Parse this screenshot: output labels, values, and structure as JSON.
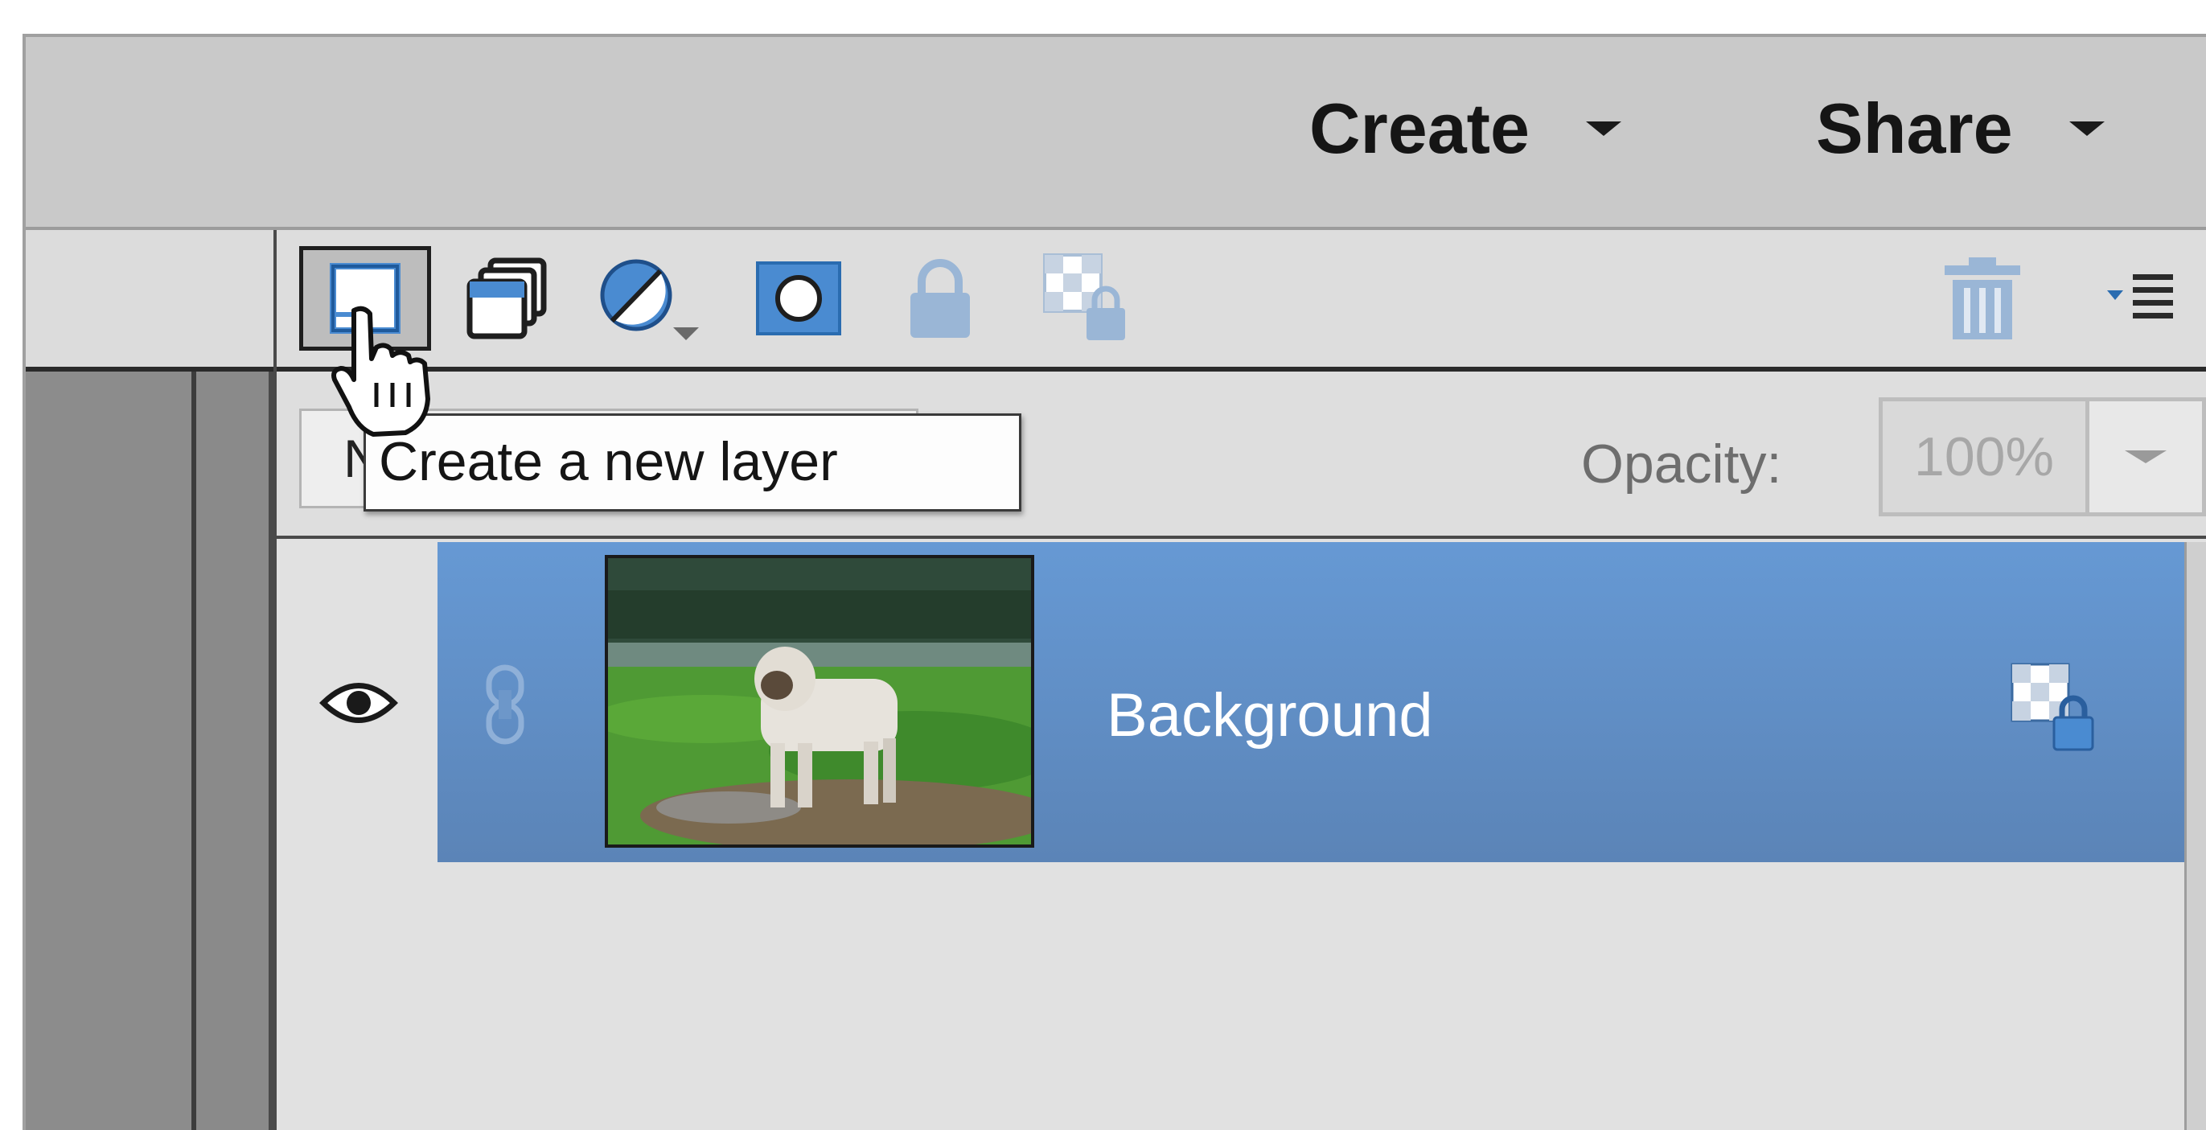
{
  "menubar": {
    "create_label": "Create",
    "share_label": "Share"
  },
  "layers_panel": {
    "toolbar": {
      "new_layer_icon": "new-layer-icon",
      "duplicate_icon": "stacked-pages-icon",
      "adjustment_icon": "half-circle-icon",
      "mask_icon": "layer-mask-icon",
      "lock_all_icon": "lock-icon",
      "lock_transparency_icon": "checker-lock-icon",
      "delete_icon": "trash-icon",
      "panel_menu_icon": "panel-menu-icon"
    },
    "blend_mode": {
      "value": "N"
    },
    "opacity": {
      "label": "Opacity:",
      "value": "100%"
    },
    "layers": [
      {
        "name": "Background",
        "visible": true,
        "locked": true,
        "selected": true
      }
    ]
  },
  "tooltip": {
    "text": "Create a new layer"
  },
  "colors": {
    "selected_row": "#6699d4",
    "menubar": "#c9c9c9",
    "panel": "#e1e1e1",
    "icon_blue": "#4a8bd1"
  }
}
